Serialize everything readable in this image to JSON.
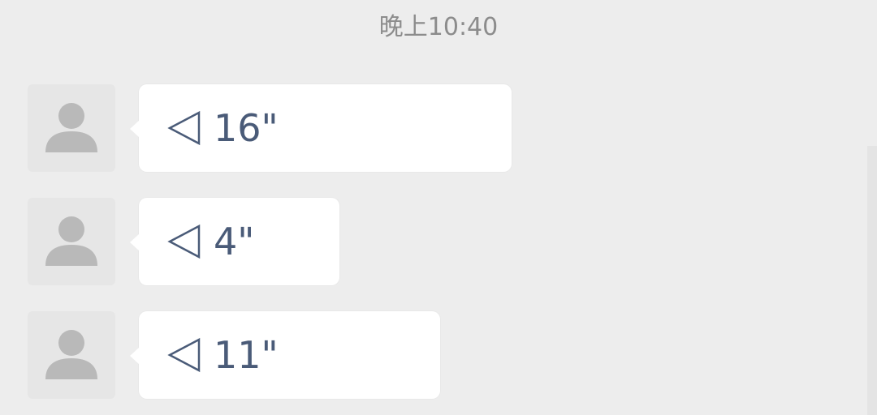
{
  "chat": {
    "timestamp": "晚上10:40",
    "messages": [
      {
        "duration": "16\"",
        "type": "voice"
      },
      {
        "duration": "4\"",
        "type": "voice"
      },
      {
        "duration": "11\"",
        "type": "voice"
      }
    ]
  },
  "icons": {
    "avatar": "default-person-icon",
    "voice": "voice-play-triangle-icon"
  },
  "colors": {
    "background": "#ededed",
    "bubble": "#ffffff",
    "duration_text": "#4a5b78",
    "timestamp_text": "#8c8c8c",
    "avatar_bg": "#e6e6e6",
    "avatar_figure": "#b9b9b9"
  }
}
